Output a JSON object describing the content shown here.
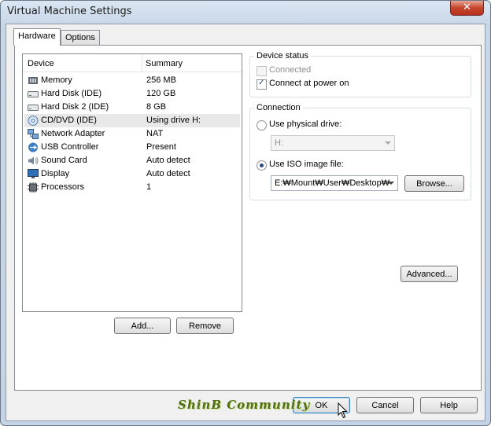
{
  "window": {
    "title": "Virtual Machine Settings",
    "close_glyph": "✕"
  },
  "tabs": [
    {
      "label": "Hardware"
    },
    {
      "label": "Options"
    }
  ],
  "device_list": {
    "headers": {
      "device": "Device",
      "summary": "Summary"
    },
    "rows": [
      {
        "name": "Memory",
        "summary": "256 MB",
        "icon": "memory-icon"
      },
      {
        "name": "Hard Disk (IDE)",
        "summary": "120 GB",
        "icon": "hard-disk-icon"
      },
      {
        "name": "Hard Disk 2 (IDE)",
        "summary": "8 GB",
        "icon": "hard-disk-icon"
      },
      {
        "name": "CD/DVD (IDE)",
        "summary": "Using drive H:",
        "icon": "cd-dvd-icon",
        "selected": true
      },
      {
        "name": "Network Adapter",
        "summary": "NAT",
        "icon": "network-adapter-icon"
      },
      {
        "name": "USB Controller",
        "summary": "Present",
        "icon": "usb-icon"
      },
      {
        "name": "Sound Card",
        "summary": "Auto detect",
        "icon": "sound-card-icon"
      },
      {
        "name": "Display",
        "summary": "Auto detect",
        "icon": "display-icon"
      },
      {
        "name": "Processors",
        "summary": "1",
        "icon": "processor-icon"
      }
    ]
  },
  "buttons": {
    "add": "Add...",
    "remove": "Remove",
    "browse": "Browse...",
    "advanced": "Advanced...",
    "ok": "OK",
    "cancel": "Cancel",
    "help": "Help"
  },
  "device_status": {
    "legend": "Device status",
    "connected_label": "Connected",
    "connected_checked": false,
    "connected_disabled": true,
    "power_on_label": "Connect at power on",
    "power_on_checked": true
  },
  "connection": {
    "legend": "Connection",
    "physical_label": "Use physical drive:",
    "physical_value": "H:",
    "iso_label": "Use ISO image file:",
    "iso_value": "E:₩Mount₩User₩Desktop₩",
    "selected": "iso"
  },
  "watermark": "ShinB Community",
  "colors": {
    "accent": "#2a4b7c",
    "close_red": "#c7452c",
    "watermark_green": "#4f6f12"
  }
}
